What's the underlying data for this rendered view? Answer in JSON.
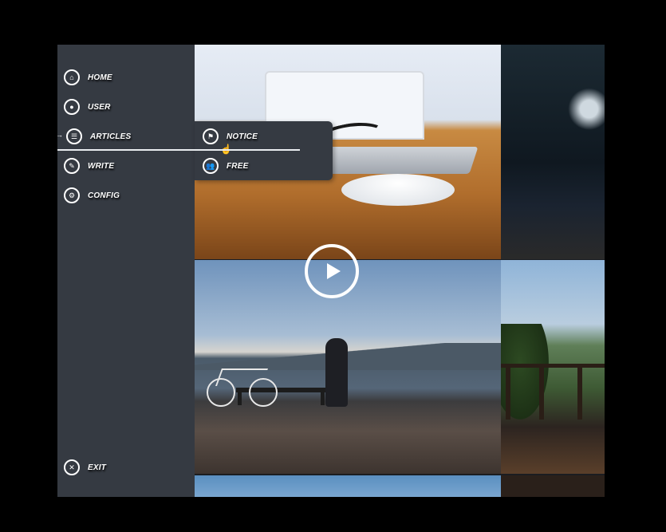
{
  "sidebar": {
    "items": [
      {
        "label": "HOME",
        "icon": "home-icon",
        "glyph": "⌂"
      },
      {
        "label": "USER",
        "icon": "user-icon",
        "glyph": "●"
      },
      {
        "label": "ARTICLES",
        "icon": "list-icon",
        "glyph": "☰"
      },
      {
        "label": "WRITE",
        "icon": "pencil-icon",
        "glyph": "✎"
      },
      {
        "label": "CONFIG",
        "icon": "gear-icon",
        "glyph": "⚙"
      }
    ],
    "exit": {
      "label": "EXIT",
      "icon": "close-icon",
      "glyph": "✕"
    },
    "active_indicator": "→"
  },
  "submenu": {
    "items": [
      {
        "label": "NOTICE",
        "icon": "flag-icon",
        "glyph": "⚑"
      },
      {
        "label": "FREE",
        "icon": "group-icon",
        "glyph": "👥"
      }
    ]
  },
  "colors": {
    "sidebar_bg": "#353a42",
    "text": "#ffffff",
    "page_bg": "#000000"
  }
}
